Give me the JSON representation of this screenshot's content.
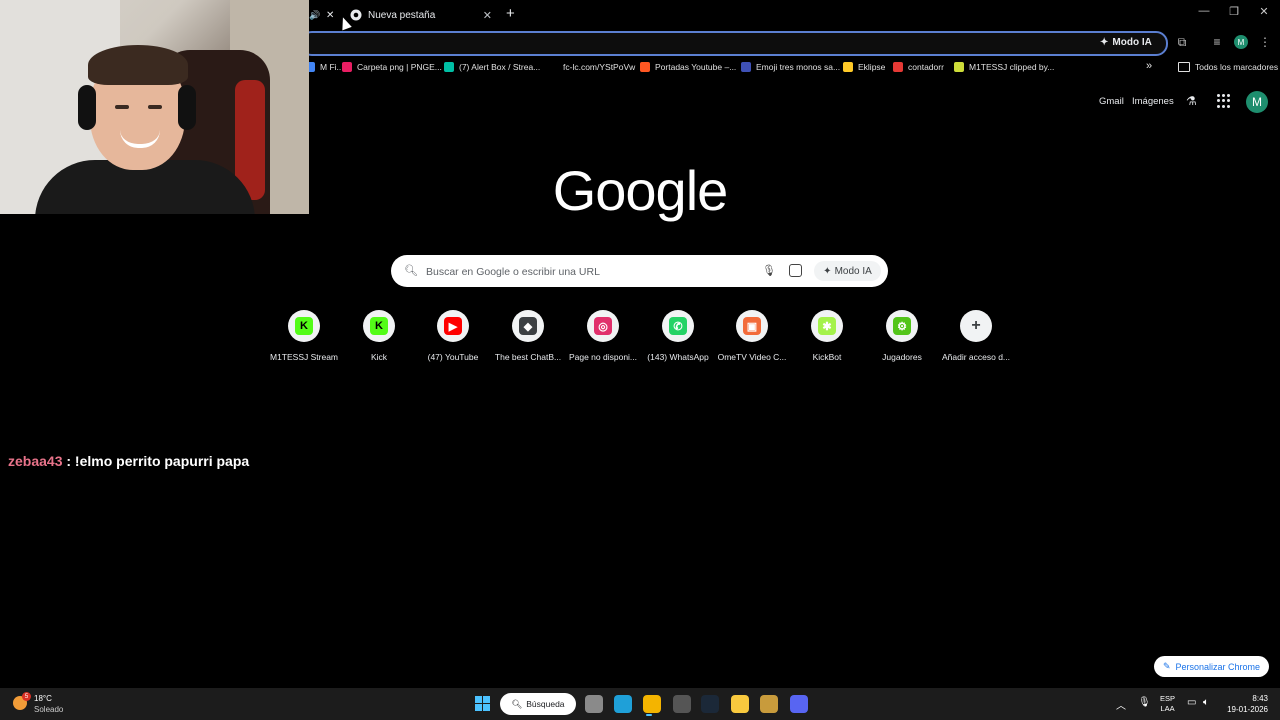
{
  "browser": {
    "active_tab_title": "Nueva pestaña",
    "omnibox_modo_ia": "Modo IA",
    "profile_initial": "M"
  },
  "bookmarks": {
    "items": [
      {
        "label": "M Fi...",
        "color": "#4285f4"
      },
      {
        "label": "Carpeta png | PNGE...",
        "color": "#e91e63"
      },
      {
        "label": "(7) Alert Box / Strea...",
        "color": "#00bfa5"
      },
      {
        "label": "fc-lc.com/YStPoVw",
        "color": "#000000"
      },
      {
        "label": "Portadas Youtube –...",
        "color": "#ff5722"
      },
      {
        "label": "Emoji tres monos sa...",
        "color": "#3f51b5"
      },
      {
        "label": "Eklipse",
        "color": "#ffca28"
      },
      {
        "label": "contadorr",
        "color": "#e53935"
      },
      {
        "label": "M1TESSJ clipped by...",
        "color": "#cddc39"
      }
    ],
    "more": "»",
    "all_bookmarks": "Todos los marcadores"
  },
  "header": {
    "gmail": "Gmail",
    "imagenes": "Imágenes",
    "avatar_initial": "M"
  },
  "logo": "Google",
  "search": {
    "placeholder": "Buscar en Google o escribir una URL",
    "modo_ia": "Modo IA"
  },
  "shortcuts": [
    {
      "label": "M1TESSJ Stream",
      "icon": "kick-icon",
      "color": "#53fc18",
      "glyph": "K"
    },
    {
      "label": "Kick",
      "icon": "kick-icon",
      "color": "#53fc18",
      "glyph": "K"
    },
    {
      "label": "(47) YouTube",
      "icon": "youtube-icon",
      "color": "#ff0000",
      "glyph": "▶"
    },
    {
      "label": "The best ChatB...",
      "icon": "chatbot-icon",
      "color": "#3c4043",
      "glyph": "◆"
    },
    {
      "label": "Page no disponi...",
      "icon": "instagram-icon",
      "color": "#e1306c",
      "glyph": "◎"
    },
    {
      "label": "(143) WhatsApp",
      "icon": "whatsapp-icon",
      "color": "#25d366",
      "glyph": "✆"
    },
    {
      "label": "OmeTV Video C...",
      "icon": "ometv-icon",
      "color": "#f26b3a",
      "glyph": "▣"
    },
    {
      "label": "KickBot",
      "icon": "kickbot-icon",
      "color": "#a4f24b",
      "glyph": "✱"
    },
    {
      "label": "Jugadores",
      "icon": "gear-icon",
      "color": "#53c51a",
      "glyph": "⚙"
    },
    {
      "label": "Añadir acceso d...",
      "icon": "plus-icon",
      "color": "#3c4043",
      "glyph": "+"
    }
  ],
  "chat": {
    "user": "zebaa43",
    "message": " : !elmo perrito papurri papa"
  },
  "personalize": "Personalizar Chrome",
  "taskbar": {
    "weather_temp": "18°C",
    "weather_desc": "Soleado",
    "weather_badge": "5",
    "search_label": "Búsqueda",
    "lang_top": "ESP",
    "lang_bottom": "LAA",
    "time": "8:43",
    "date": "19-01-2026",
    "apps": [
      {
        "name": "file-explorer-gray",
        "color": "#8a8a8a"
      },
      {
        "name": "edge",
        "color": "#1fa0d8"
      },
      {
        "name": "chrome",
        "color": "#f4b400"
      },
      {
        "name": "app-swirl",
        "color": "#555555"
      },
      {
        "name": "steam",
        "color": "#1b2838"
      },
      {
        "name": "file-explorer",
        "color": "#f8c93e"
      },
      {
        "name": "league",
        "color": "#c89b3c"
      },
      {
        "name": "discord",
        "color": "#5865f2"
      }
    ]
  }
}
